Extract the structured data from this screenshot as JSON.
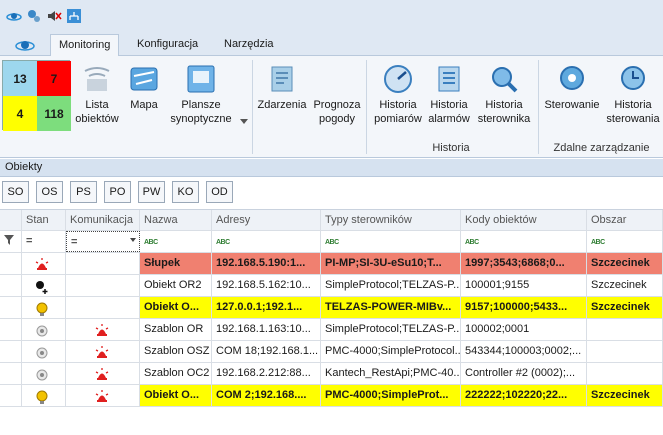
{
  "quick_access": {
    "icons": [
      "satellite-icon",
      "plug-gear-icon",
      "mute-speaker-icon",
      "network-tree-icon"
    ]
  },
  "tabs": [
    {
      "label": "Monitoring",
      "active": true
    },
    {
      "label": "Konfiguracja",
      "active": false
    },
    {
      "label": "Narzędzia",
      "active": false
    }
  ],
  "status_counts": {
    "top_left": {
      "value": "13",
      "color": "#9dd7ee"
    },
    "top_right": {
      "value": "7",
      "color": "#ff0000"
    },
    "bottom_left": {
      "value": "4",
      "color": "#ffff00"
    },
    "bottom_right": {
      "value": "118",
      "color": "#7ddd7d"
    }
  },
  "ribbon": {
    "buttons": {
      "lista": "Lista\nobiektów",
      "mapa": "Mapa",
      "plansze": "Plansze\nsynoptyczne",
      "zdarzenia": "Zdarzenia",
      "prognoza": "Prognoza\npogody",
      "historia_pomiarow": "Historia\npomiarów",
      "historia_alarmow": "Historia\nalarmów",
      "historia_sterownika": "Historia\nsterownika",
      "sterowanie": "Sterowanie",
      "historia_sterowania": "Historia\nsterowania"
    },
    "groups": {
      "historia": "Historia",
      "zdalne": "Zdalne zarządzanie"
    }
  },
  "panel": {
    "title": "Obiekty"
  },
  "filter_buttons": [
    "SO",
    "OS",
    "PS",
    "PO",
    "PW",
    "KO",
    "OD"
  ],
  "table": {
    "columns": [
      "Stan",
      "Komunikacja",
      "Nazwa",
      "Adresy",
      "Typy sterowników",
      "Kody obiektów",
      "Obszar"
    ],
    "filter_row": {
      "stan": "=",
      "komunikacja": "="
    },
    "rows": [
      {
        "state_icon": "red-alarm-icon",
        "comm_icon": "",
        "nazwa": "Słupek",
        "adresy": "192.168.5.190:1...",
        "typy": "PI-MP;SI-3U-eSu10;T...",
        "kody": "1997;3543;6868;0...",
        "obszar": "Szczecinek",
        "highlight": "red"
      },
      {
        "state_icon": "black-dot-plus-icon",
        "comm_icon": "",
        "nazwa": "Obiekt OR2",
        "adresy": "192.168.5.162:10...",
        "typy": "SimpleProtocol;TELZAS-P...",
        "kody": "100001;9155",
        "obszar": "Szczecinek",
        "highlight": ""
      },
      {
        "state_icon": "yellow-bulb-icon",
        "comm_icon": "",
        "nazwa": "Obiekt O...",
        "adresy": "127.0.0.1;192.1...",
        "typy": "TELZAS-POWER-MIBv...",
        "kody": "9157;100000;5433...",
        "obszar": "Szczecinek",
        "highlight": "yellow"
      },
      {
        "state_icon": "gray-dot-icon",
        "comm_icon": "red-alarm-icon",
        "nazwa": "Szablon OR",
        "adresy": "192.168.1.163:10...",
        "typy": "SimpleProtocol;TELZAS-P...",
        "kody": "100002;0001",
        "obszar": "",
        "highlight": ""
      },
      {
        "state_icon": "gray-dot-icon",
        "comm_icon": "red-alarm-icon",
        "nazwa": "Szablon OSZ",
        "adresy": "COM 18;192.168.1...",
        "typy": "PMC-4000;SimpleProtocol...",
        "kody": "543344;100003;0002;...",
        "obszar": "",
        "highlight": ""
      },
      {
        "state_icon": "gray-dot-icon",
        "comm_icon": "red-alarm-icon",
        "nazwa": "Szablon OC2",
        "adresy": "192.168.2.212:88...",
        "typy": "Kantech_RestApi;PMC-40...",
        "kody": "Controller #2 (0002);...",
        "obszar": "",
        "highlight": ""
      },
      {
        "state_icon": "yellow-bulb-icon",
        "comm_icon": "red-alarm-icon",
        "nazwa": "Obiekt O...",
        "adresy": "COM 2;192.168....",
        "typy": "PMC-4000;SimpleProt...",
        "kody": "222222;102220;22...",
        "obszar": "Szczecinek",
        "highlight": "yellow"
      }
    ]
  }
}
